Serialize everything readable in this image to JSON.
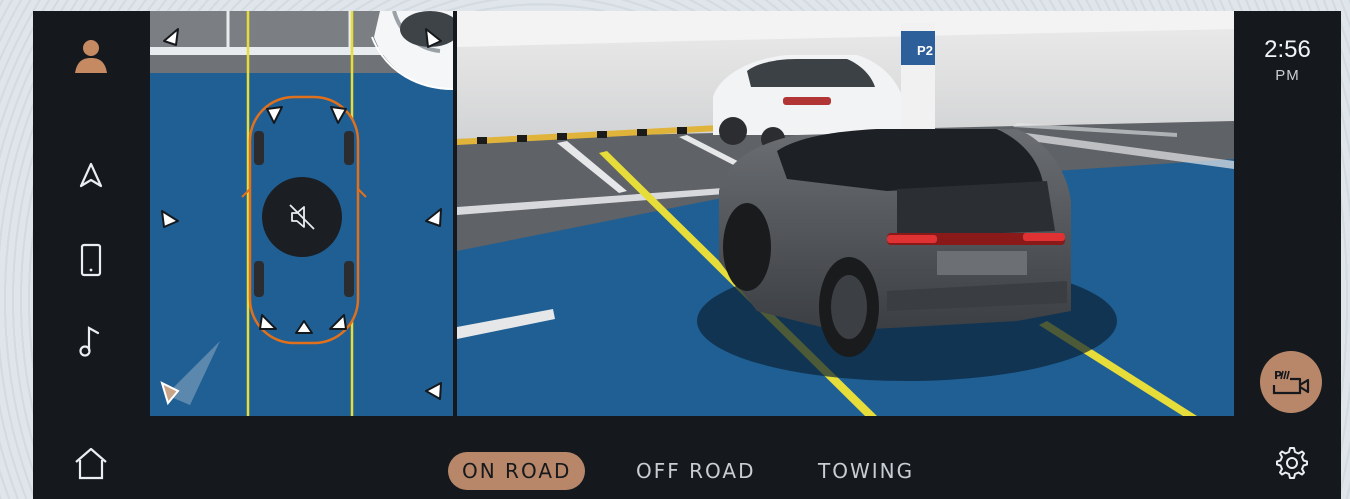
{
  "clock": {
    "time": "2:56",
    "ampm": "PM"
  },
  "sidebar": {
    "items": [
      {
        "name": "profile",
        "icon": "user-avatar-icon"
      },
      {
        "name": "navigation",
        "icon": "navigation-arrow-icon"
      },
      {
        "name": "phone",
        "icon": "phone-icon"
      },
      {
        "name": "media",
        "icon": "music-note-icon"
      },
      {
        "name": "home",
        "icon": "home-icon"
      }
    ]
  },
  "right_rail": {
    "camera_button_icon": "parking-camera-icon",
    "settings_icon": "gear-icon"
  },
  "top_view": {
    "mute_icon": "speaker-muted-icon"
  },
  "camera_view": {
    "pillar_label": "P2"
  },
  "tabs": [
    {
      "label": "ON ROAD",
      "active": true
    },
    {
      "label": "OFF ROAD",
      "active": false
    },
    {
      "label": "TOWING",
      "active": false
    }
  ],
  "colors": {
    "accent": "#b8876a",
    "background": "#15191d",
    "floor_blue": "#1f5f93",
    "guide_yellow": "#e7dd3a",
    "outline_orange": "#e0701c"
  }
}
